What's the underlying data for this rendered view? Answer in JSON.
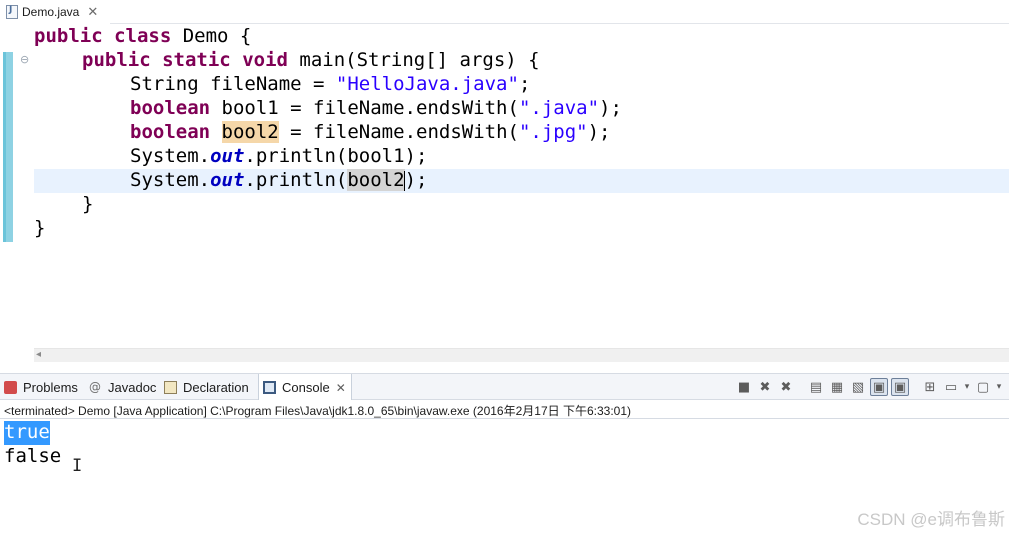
{
  "editor_tab": {
    "title": "Demo.java",
    "close": "✕"
  },
  "code_lines": {
    "l1": {
      "kw1": "public",
      "kw2": "class",
      "rest": " Demo {"
    },
    "l2": {
      "kw1": "public",
      "kw2": "static",
      "kw3": "void",
      "rest": " main(String[] args) {"
    },
    "l3": {
      "pre": "String fileName = ",
      "str": "\"HelloJava.java\"",
      "post": ";"
    },
    "l4": {
      "kw": "boolean",
      "pre": " bool1 = fileName.endsWith(",
      "str": "\".java\"",
      "post": ");"
    },
    "l5": {
      "kw": "boolean",
      "var": "bool2",
      "pre": " = fileName.endsWith(",
      "str": "\".jpg\"",
      "post": ");"
    },
    "l6": {
      "pre": "System.",
      "field": "out",
      "post": ".println(bool1);"
    },
    "l7": {
      "pre": "System.",
      "field": "out",
      "mid": ".println(",
      "var": "bool2",
      "post": ");"
    },
    "l8": {
      "text": "}"
    },
    "l9": {
      "text": "}"
    }
  },
  "panel_tabs": {
    "problems": "Problems",
    "javadoc": "Javadoc",
    "declaration": "Declaration",
    "console": "Console",
    "close": "✕"
  },
  "console": {
    "terminated": "<terminated> Demo [Java Application] C:\\Program Files\\Java\\jdk1.8.0_65\\bin\\javaw.exe (2016年2月17日 下午6:33:01)",
    "output": [
      "true",
      "false"
    ]
  },
  "watermark": "CSDN @e调布鲁斯",
  "colors": {
    "keyword": "#7f0055",
    "string": "#2a00ff",
    "static_field": "#0000c0",
    "selection": "#3399ff"
  }
}
